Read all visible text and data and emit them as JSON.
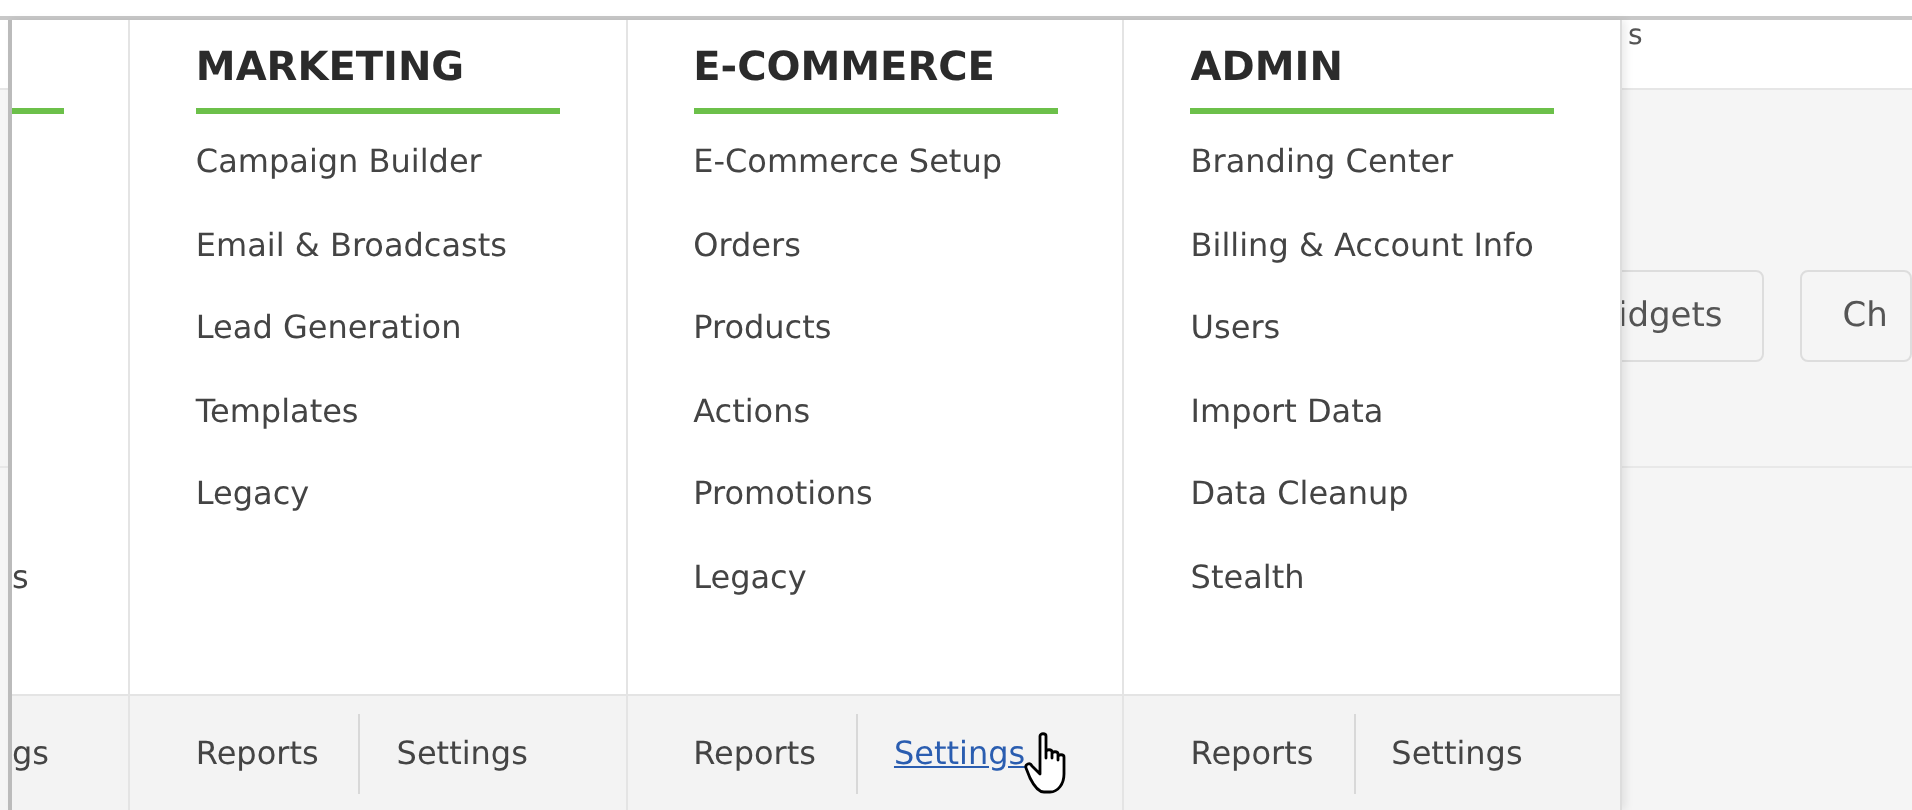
{
  "background": {
    "top_text": "s",
    "buttons": [
      {
        "label": "idgets"
      },
      {
        "label": "Ch"
      }
    ]
  },
  "menu": {
    "partial_column": {
      "item": "s",
      "footer_link": "gs"
    },
    "columns": [
      {
        "heading": "MARKETING",
        "items": [
          "Campaign Builder",
          "Email & Broadcasts",
          "Lead Generation",
          "Templates",
          "Legacy"
        ],
        "footer": [
          {
            "label": "Reports",
            "hovered": false
          },
          {
            "label": "Settings",
            "hovered": false
          }
        ]
      },
      {
        "heading": "E-COMMERCE",
        "items": [
          "E-Commerce Setup",
          "Orders",
          "Products",
          "Actions",
          "Promotions",
          "Legacy"
        ],
        "footer": [
          {
            "label": "Reports",
            "hovered": false
          },
          {
            "label": "Settings",
            "hovered": true
          }
        ]
      },
      {
        "heading": "ADMIN",
        "items": [
          "Branding Center",
          "Billing & Account Info",
          "Users",
          "Import Data",
          "Data Cleanup",
          "Stealth"
        ],
        "footer": [
          {
            "label": "Reports",
            "hovered": false
          },
          {
            "label": "Settings",
            "hovered": false
          }
        ]
      }
    ]
  }
}
